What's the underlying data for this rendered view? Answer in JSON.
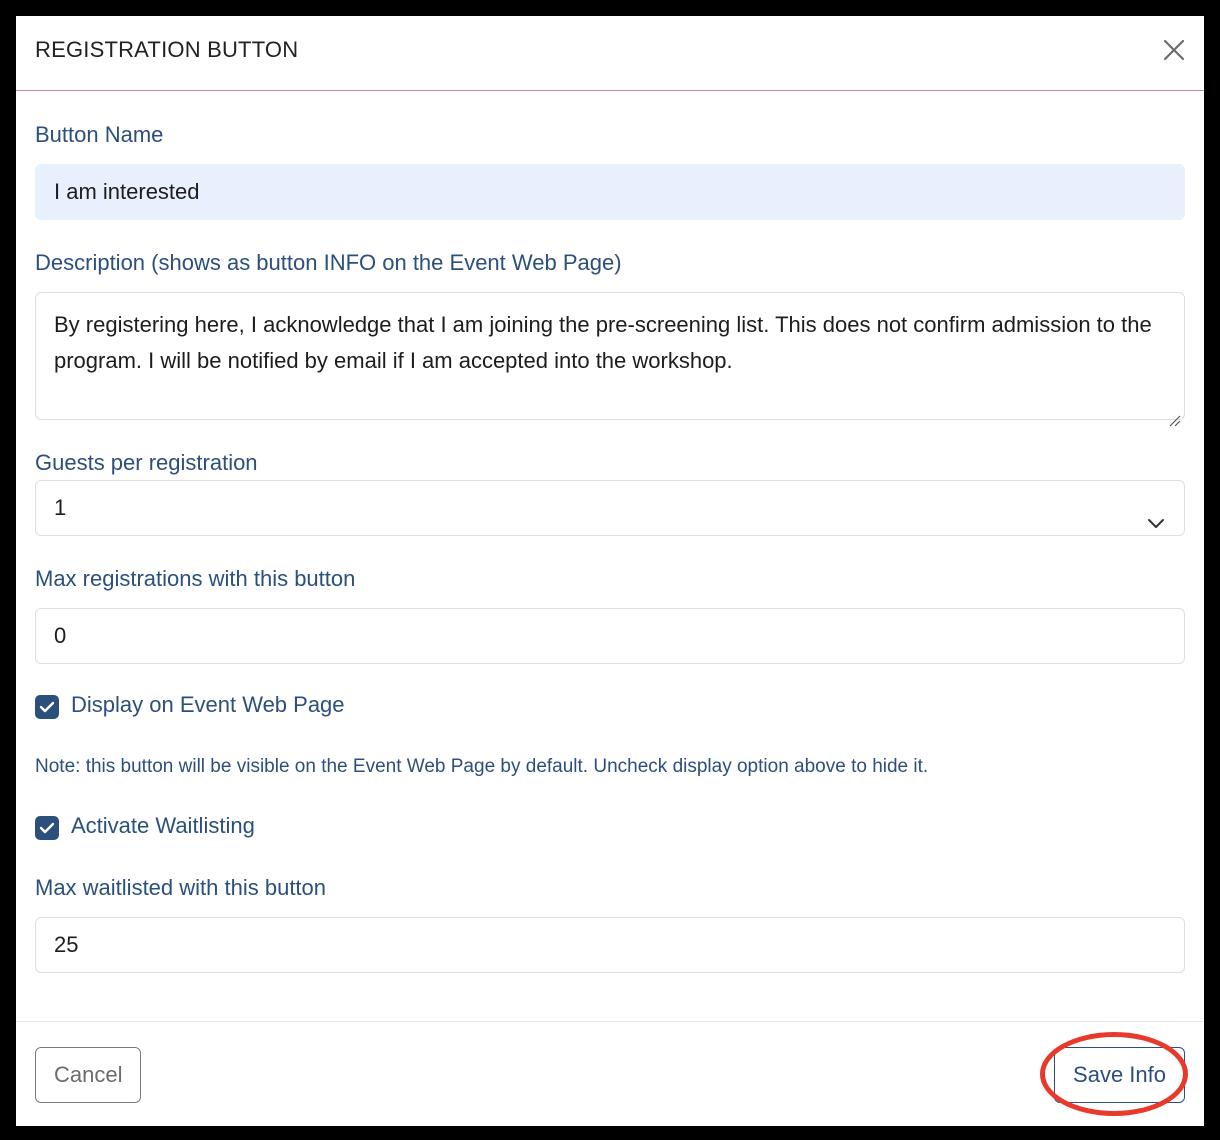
{
  "modal": {
    "title": "REGISTRATION BUTTON",
    "close_icon": "close-icon"
  },
  "form": {
    "button_name": {
      "label": "Button Name",
      "value": "I am interested"
    },
    "description": {
      "label": "Description (shows as button INFO on the Event Web Page)",
      "value": "By registering here, I acknowledge that I am joining the pre-screening list. This does not confirm admission to the program. I will be notified by email if I am accepted into the workshop."
    },
    "guests_per_registration": {
      "label": "Guests per registration",
      "selected": "1",
      "icon": "chevron-down-icon"
    },
    "max_registrations": {
      "label": "Max registrations with this button",
      "value": "0"
    },
    "display_on_event_page": {
      "label": "Display on Event Web Page",
      "checked": true
    },
    "note": "Note: this button will be visible on the Event Web Page by default. Uncheck display option above to hide it.",
    "activate_waitlisting": {
      "label": "Activate Waitlisting",
      "checked": true
    },
    "max_waitlisted": {
      "label": "Max waitlisted with this button",
      "value": "25"
    }
  },
  "footer": {
    "cancel_label": "Cancel",
    "save_label": "Save Info"
  },
  "colors": {
    "accent": "#2c4f7c",
    "autofill_bg": "#e8f0fe",
    "highlight_ring": "#e8392b",
    "header_divider": "#c98a8f"
  }
}
